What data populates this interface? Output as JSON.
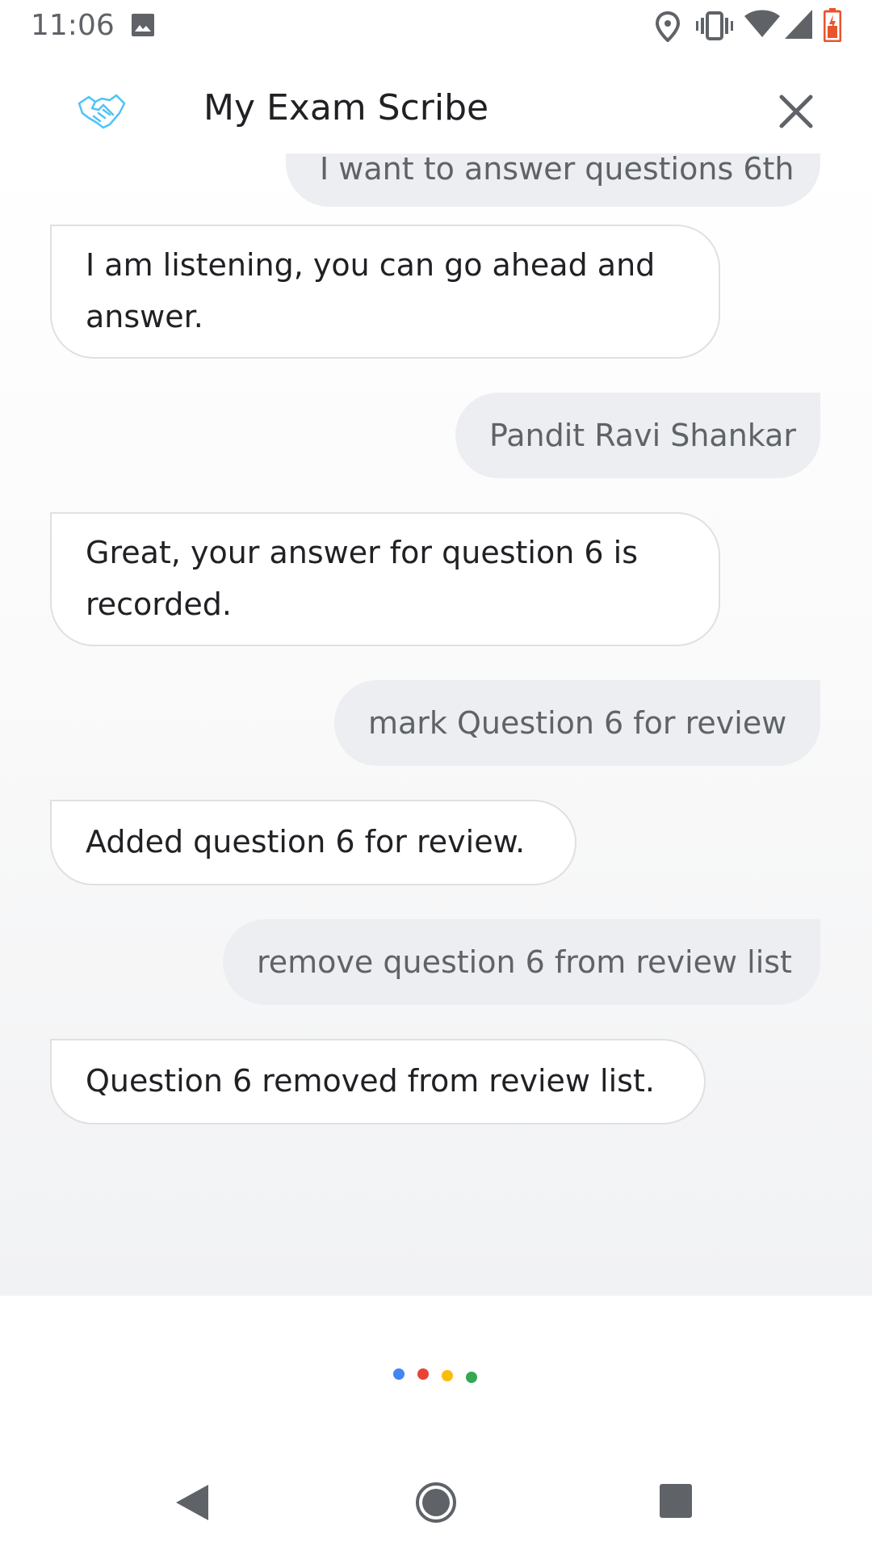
{
  "status_bar": {
    "time": "11:06",
    "icons": [
      "image-icon",
      "location-icon",
      "vibrate-icon",
      "wifi-icon",
      "signal-icon",
      "battery-icon"
    ]
  },
  "header": {
    "title": "My Exam Scribe",
    "logo_icon": "handshake-icon",
    "close_icon": "close-icon"
  },
  "messages": [
    {
      "from": "user",
      "text": "I want to answer questions 6th"
    },
    {
      "from": "assistant",
      "text": "I am listening, you can go ahead and answer."
    },
    {
      "from": "user",
      "text": "Pandit Ravi Shankar"
    },
    {
      "from": "assistant",
      "text": "Great, your answer for question 6 is recorded."
    },
    {
      "from": "user",
      "text": "mark Question 6 for review"
    },
    {
      "from": "assistant",
      "text": "Added question 6 for review."
    },
    {
      "from": "user",
      "text": "remove question 6 from review list"
    },
    {
      "from": "assistant",
      "text": "Question 6 removed from review list."
    }
  ],
  "assistant_indicator": {
    "colors": [
      "#4285F4",
      "#EA4335",
      "#FBBC05",
      "#34A853"
    ]
  },
  "nav_bar": {
    "icons": [
      "back-icon",
      "home-icon",
      "recents-icon"
    ]
  },
  "colors": {
    "user_bubble": "#eceef1",
    "assistant_bubble": "#ffffff",
    "logo": "#4fc3f7",
    "battery": "#e8542d"
  }
}
